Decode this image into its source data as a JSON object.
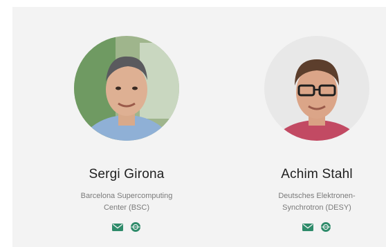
{
  "people": [
    {
      "name": "Sergi Girona",
      "affiliation_line1": "Barcelona Supercomputing",
      "affiliation_line2": "Center (BSC)",
      "icons": [
        "email-icon",
        "web-icon"
      ]
    },
    {
      "name": "Achim Stahl",
      "affiliation_line1": "Deutsches Elektronen-",
      "affiliation_line2": "Synchrotron (DESY)",
      "icons": [
        "email-icon",
        "web-icon"
      ]
    }
  ],
  "colors": {
    "panel_bg": "#f3f3f3",
    "icon_green": "#2e8b6a",
    "name_text": "#202020",
    "affiliation_text": "#7a7a7a"
  }
}
